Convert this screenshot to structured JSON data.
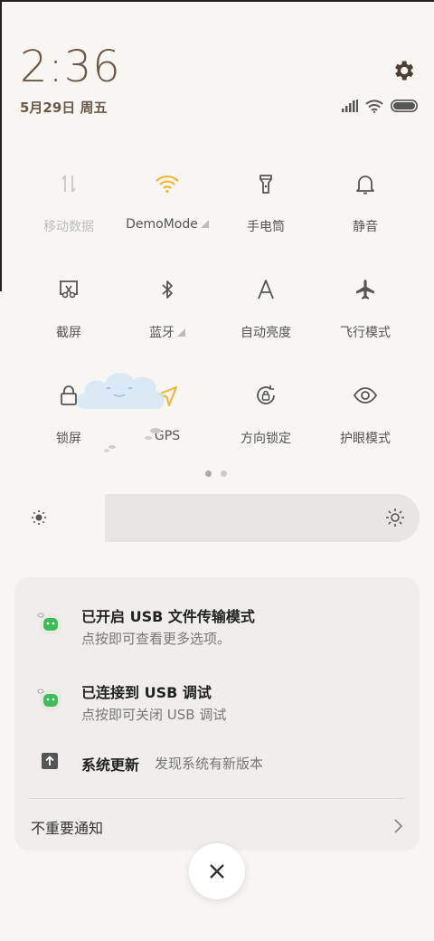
{
  "header": {
    "time": "2:36",
    "date": "5月29日 周五"
  },
  "tiles": [
    {
      "label": "移动数据",
      "icon": "mobile-data-icon",
      "active": false
    },
    {
      "label": "DemoMode",
      "icon": "wifi-icon",
      "active": true,
      "expandable": true
    },
    {
      "label": "手电筒",
      "icon": "flashlight-icon",
      "active": false
    },
    {
      "label": "静音",
      "icon": "bell-icon",
      "active": false
    },
    {
      "label": "截屏",
      "icon": "screenshot-icon",
      "active": false
    },
    {
      "label": "蓝牙",
      "icon": "bluetooth-icon",
      "active": false,
      "expandable": true
    },
    {
      "label": "自动亮度",
      "icon": "auto-brightness-icon",
      "active": false
    },
    {
      "label": "飞行模式",
      "icon": "airplane-icon",
      "active": false
    },
    {
      "label": "锁屏",
      "icon": "lock-icon",
      "active": false
    },
    {
      "label": "GPS",
      "icon": "location-icon",
      "active": true
    },
    {
      "label": "方向锁定",
      "icon": "rotation-lock-icon",
      "active": false
    },
    {
      "label": "护眼模式",
      "icon": "eye-icon",
      "active": false
    }
  ],
  "brightness": {
    "level": 0.22
  },
  "notifications": [
    {
      "title": "已开启 USB 文件传输模式",
      "subtitle": "点按即可查看更多选项。",
      "icon": "android-robot-icon"
    },
    {
      "title": "已连接到 USB 调试",
      "subtitle": "点按即可关闭 USB 调试",
      "icon": "android-robot-icon"
    },
    {
      "title": "系统更新",
      "subtitle": "发现系统有新版本",
      "icon": "update-arrow-icon"
    }
  ],
  "unimportant_label": "不重要通知",
  "colors": {
    "accent": "#f0b72f",
    "text": "#6b5a4a"
  }
}
